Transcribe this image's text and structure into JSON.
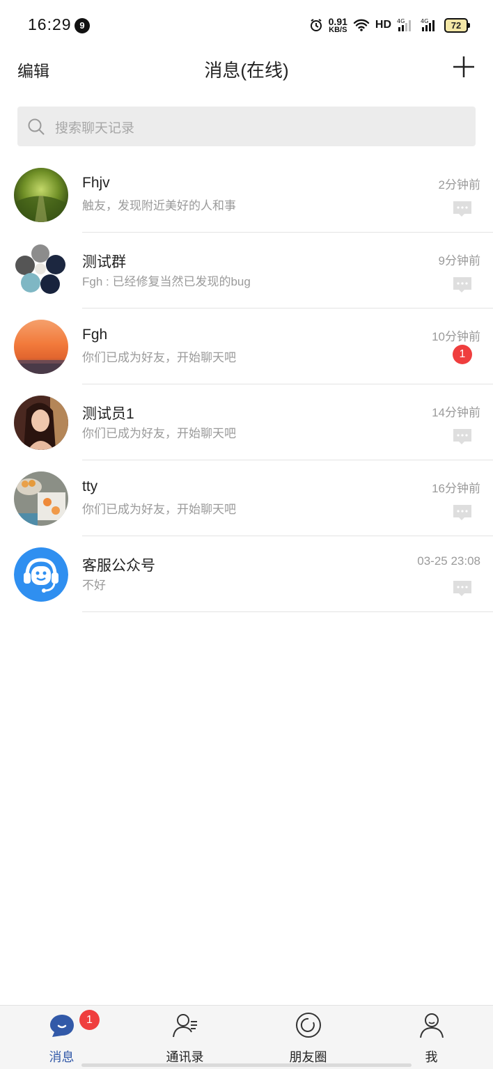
{
  "status_bar": {
    "time": "16:29",
    "notification_count": "9",
    "net_speed_value": "0.91",
    "net_speed_unit": "KB/S",
    "hd_label": "HD",
    "battery": "72"
  },
  "header": {
    "edit_label": "编辑",
    "title": "消息(在线)",
    "add_icon": "plus-icon"
  },
  "search": {
    "placeholder": "搜索聊天记录",
    "icon": "search-icon"
  },
  "conversations": [
    {
      "name": "Fhjv",
      "preview": "触友，发现附近美好的人和事",
      "time": "2分钟前",
      "avatar": "forest-photo",
      "unread": null
    },
    {
      "name": "测试群",
      "preview": "Fgh : 已经修复当然已发现的bug",
      "time": "9分钟前",
      "avatar": "group-collage",
      "unread": null
    },
    {
      "name": "Fgh",
      "preview": "你们已成为好友，开始聊天吧",
      "time": "10分钟前",
      "avatar": "sunset-photo",
      "unread": "1"
    },
    {
      "name": "测试员1",
      "preview": "你们已成为好友，开始聊天吧",
      "time": "14分钟前",
      "avatar": "portrait-photo",
      "unread": null
    },
    {
      "name": "tty",
      "preview": "你们已成为好友，开始聊天吧",
      "time": "16分钟前",
      "avatar": "food-photo",
      "unread": null
    },
    {
      "name": "客服公众号",
      "preview": "不好",
      "time": "03-25 23:08",
      "avatar": "customer-service-icon",
      "unread": null
    }
  ],
  "tabs": [
    {
      "label": "消息",
      "icon": "message-bubble-icon",
      "active": true,
      "badge": "1"
    },
    {
      "label": "通讯录",
      "icon": "contacts-icon",
      "active": false
    },
    {
      "label": "朋友圈",
      "icon": "moments-icon",
      "active": false
    },
    {
      "label": "我",
      "icon": "profile-icon",
      "active": false
    }
  ],
  "colors": {
    "accent": "#3259a8",
    "badge_red": "#ef3e3e",
    "service_blue": "#2f8ff0"
  }
}
